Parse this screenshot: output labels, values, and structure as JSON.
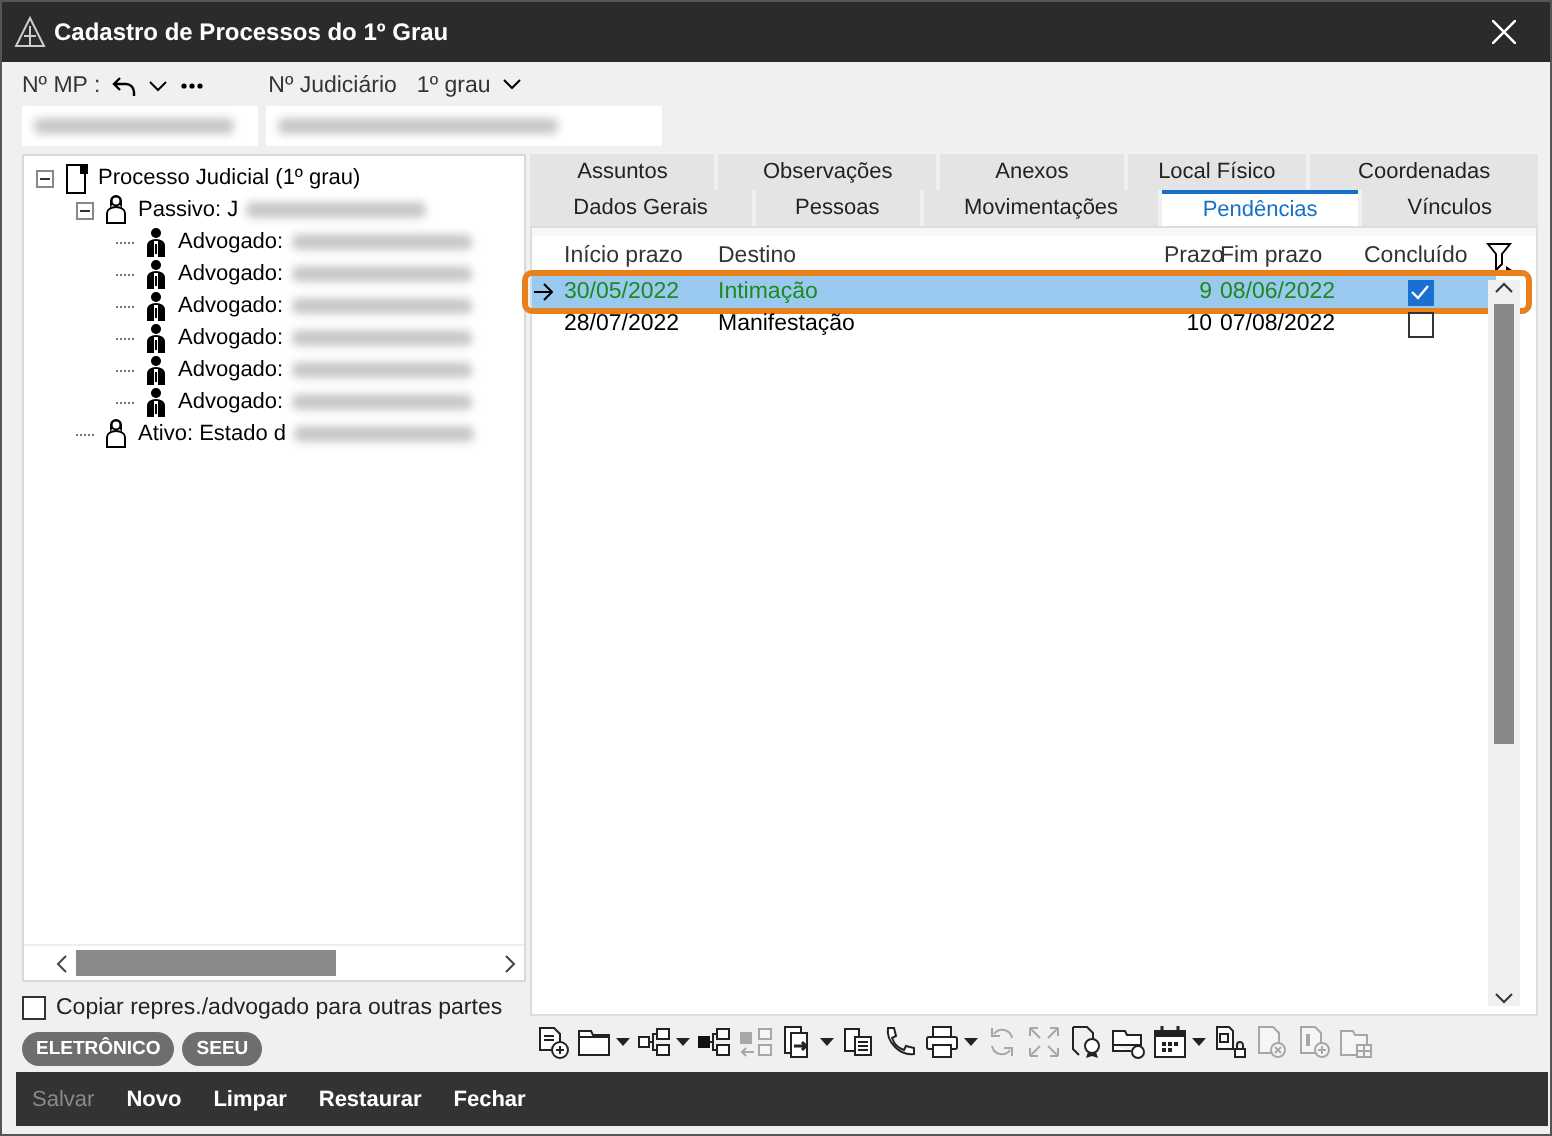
{
  "window": {
    "title": "Cadastro de Processos do 1º Grau"
  },
  "header": {
    "mp_label": "Nº MP :",
    "judicial_label": "Nº Judiciário",
    "grau": "1º grau"
  },
  "tree": {
    "label": "Processo Judicial (1º grau)",
    "expanded": true,
    "kind": "process",
    "children": [
      {
        "label": "Passivo: J",
        "expanded": true,
        "kind": "party",
        "children": [
          {
            "label": "Advogado:",
            "kind": "lawyer"
          },
          {
            "label": "Advogado:",
            "kind": "lawyer"
          },
          {
            "label": "Advogado:",
            "kind": "lawyer"
          },
          {
            "label": "Advogado:",
            "kind": "lawyer"
          },
          {
            "label": "Advogado:",
            "kind": "lawyer"
          },
          {
            "label": "Advogado:",
            "kind": "lawyer"
          }
        ]
      },
      {
        "label": "Ativo: Estado d",
        "kind": "party"
      }
    ]
  },
  "copy_option": {
    "label": "Copiar repres./advogado para outras partes",
    "checked": false
  },
  "badges": [
    "ELETRÔNICO",
    "SEEU"
  ],
  "tab_rows": [
    [
      {
        "label": "Assuntos",
        "selected": false
      },
      {
        "label": "Observações",
        "selected": false
      },
      {
        "label": "Anexos",
        "selected": false
      },
      {
        "label": "Local Físico",
        "selected": false
      },
      {
        "label": "Coordenadas",
        "selected": false
      }
    ],
    [
      {
        "label": "Dados Gerais",
        "selected": false
      },
      {
        "label": "Pessoas",
        "selected": false
      },
      {
        "label": "Movimentações",
        "selected": false
      },
      {
        "label": "Pendências",
        "selected": true
      },
      {
        "label": "Vínculos",
        "selected": false
      }
    ]
  ],
  "table": {
    "columns": [
      "Início prazo",
      "Destino",
      "Prazo",
      "Fim prazo",
      "Concluído"
    ],
    "rows": [
      {
        "cells": [
          "30/05/2022",
          "Intimação",
          "9",
          "08/06/2022"
        ],
        "concluded": true,
        "selected": true,
        "highlighted": true,
        "color": "#1e8a1e"
      },
      {
        "cells": [
          "28/07/2022",
          "Manifestação",
          "10",
          "07/08/2022"
        ],
        "concluded": false,
        "selected": false,
        "highlighted": false,
        "color": "#000000"
      }
    ]
  },
  "toolbar": [
    {
      "kind": "doc-add",
      "disabled": false,
      "dropdown": false
    },
    {
      "kind": "folder",
      "disabled": false,
      "dropdown": true
    },
    {
      "kind": "tree",
      "disabled": false,
      "dropdown": true
    },
    {
      "kind": "tree-solid",
      "disabled": false,
      "dropdown": false
    },
    {
      "kind": "tree-move",
      "disabled": true,
      "dropdown": false
    },
    {
      "kind": "doc-arrow",
      "disabled": false,
      "dropdown": true
    },
    {
      "kind": "clipboard",
      "disabled": false,
      "dropdown": false
    },
    {
      "kind": "phone",
      "disabled": false,
      "dropdown": false
    },
    {
      "kind": "printer",
      "disabled": false,
      "dropdown": true
    },
    {
      "kind": "refresh",
      "disabled": true,
      "dropdown": false
    },
    {
      "kind": "expand",
      "disabled": true,
      "dropdown": false
    },
    {
      "kind": "certificate",
      "disabled": false,
      "dropdown": false
    },
    {
      "kind": "folder-clock",
      "disabled": false,
      "dropdown": false
    },
    {
      "kind": "calendar",
      "disabled": false,
      "dropdown": true
    },
    {
      "kind": "doc-lock",
      "disabled": false,
      "dropdown": false
    },
    {
      "kind": "doc-cancel",
      "disabled": true,
      "dropdown": false
    },
    {
      "kind": "doc-info",
      "disabled": true,
      "dropdown": false
    },
    {
      "kind": "folder-grid",
      "disabled": true,
      "dropdown": false
    }
  ],
  "footer_buttons": [
    {
      "label": "Salvar",
      "disabled": true
    },
    {
      "label": "Novo",
      "disabled": false
    },
    {
      "label": "Limpar",
      "disabled": false
    },
    {
      "label": "Restaurar",
      "disabled": false
    },
    {
      "label": "Fechar",
      "disabled": false
    }
  ]
}
